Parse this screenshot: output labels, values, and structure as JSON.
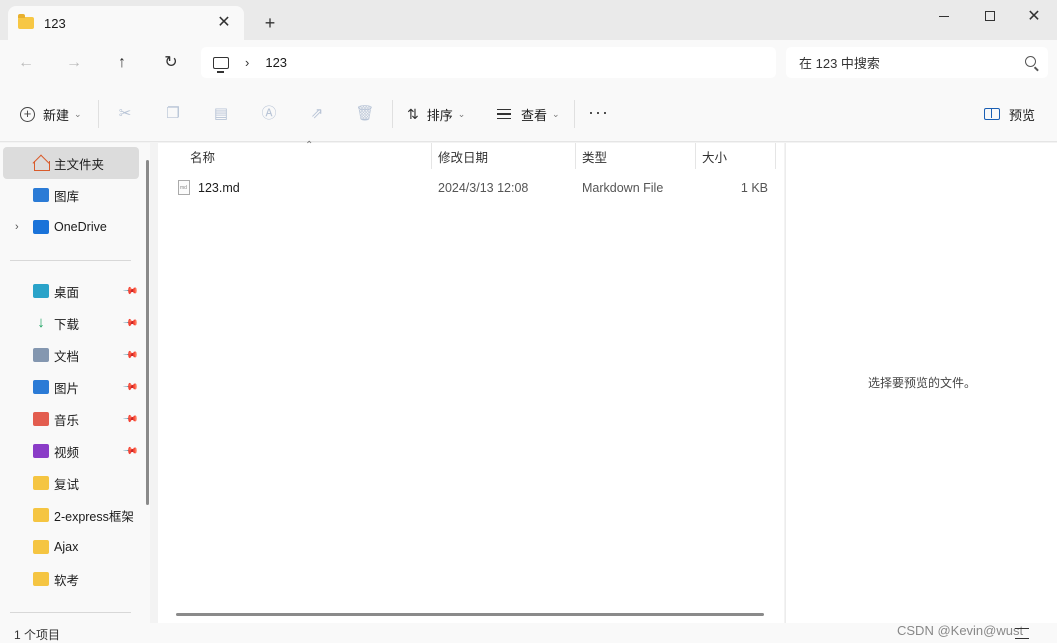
{
  "window": {
    "tab_title": "123",
    "new_tab": "+",
    "close_tab": "✕",
    "minimize": "",
    "maximize": "",
    "close": "✕"
  },
  "nav": {
    "back": "←",
    "forward": "→",
    "up": "↑",
    "refresh": "↻",
    "breadcrumb_sep": "›",
    "path": "123",
    "search_placeholder": "在 123 中搜索"
  },
  "toolbar": {
    "new_label": "新建",
    "sort_label": "排序",
    "view_label": "查看",
    "more": "···",
    "preview_label": "预览",
    "icons": [
      "cut-icon",
      "copy-icon",
      "paste-icon",
      "rename-icon",
      "share-icon",
      "delete-icon"
    ]
  },
  "sidebar": {
    "items": [
      {
        "label": "主文件夹",
        "icon": "home-icon",
        "active": true
      },
      {
        "label": "图库",
        "icon": "gallery-icon"
      },
      {
        "label": "OneDrive",
        "icon": "onedrive-icon",
        "expandable": true
      }
    ],
    "pinned": [
      {
        "label": "桌面",
        "icon": "desktop-icon",
        "pinned": true
      },
      {
        "label": "下载",
        "icon": "download-icon",
        "pinned": true
      },
      {
        "label": "文档",
        "icon": "documents-icon",
        "pinned": true
      },
      {
        "label": "图片",
        "icon": "pictures-icon",
        "pinned": true
      },
      {
        "label": "音乐",
        "icon": "music-icon",
        "pinned": true
      },
      {
        "label": "视频",
        "icon": "video-icon",
        "pinned": true
      },
      {
        "label": "复试",
        "icon": "folder-icon"
      },
      {
        "label": "2-express框架",
        "icon": "folder-icon"
      },
      {
        "label": "Ajax",
        "icon": "folder-icon"
      },
      {
        "label": "软考",
        "icon": "folder-icon"
      }
    ]
  },
  "columns": {
    "name": "名称",
    "modified": "修改日期",
    "type": "类型",
    "size": "大小"
  },
  "files": [
    {
      "name": "123.md",
      "modified": "2024/3/13 12:08",
      "type": "Markdown File",
      "size": "1 KB"
    }
  ],
  "preview_pane": {
    "message": "选择要预览的文件。"
  },
  "status": {
    "item_count": "1 个项目",
    "watermark": "CSDN @Kevin@wust"
  }
}
